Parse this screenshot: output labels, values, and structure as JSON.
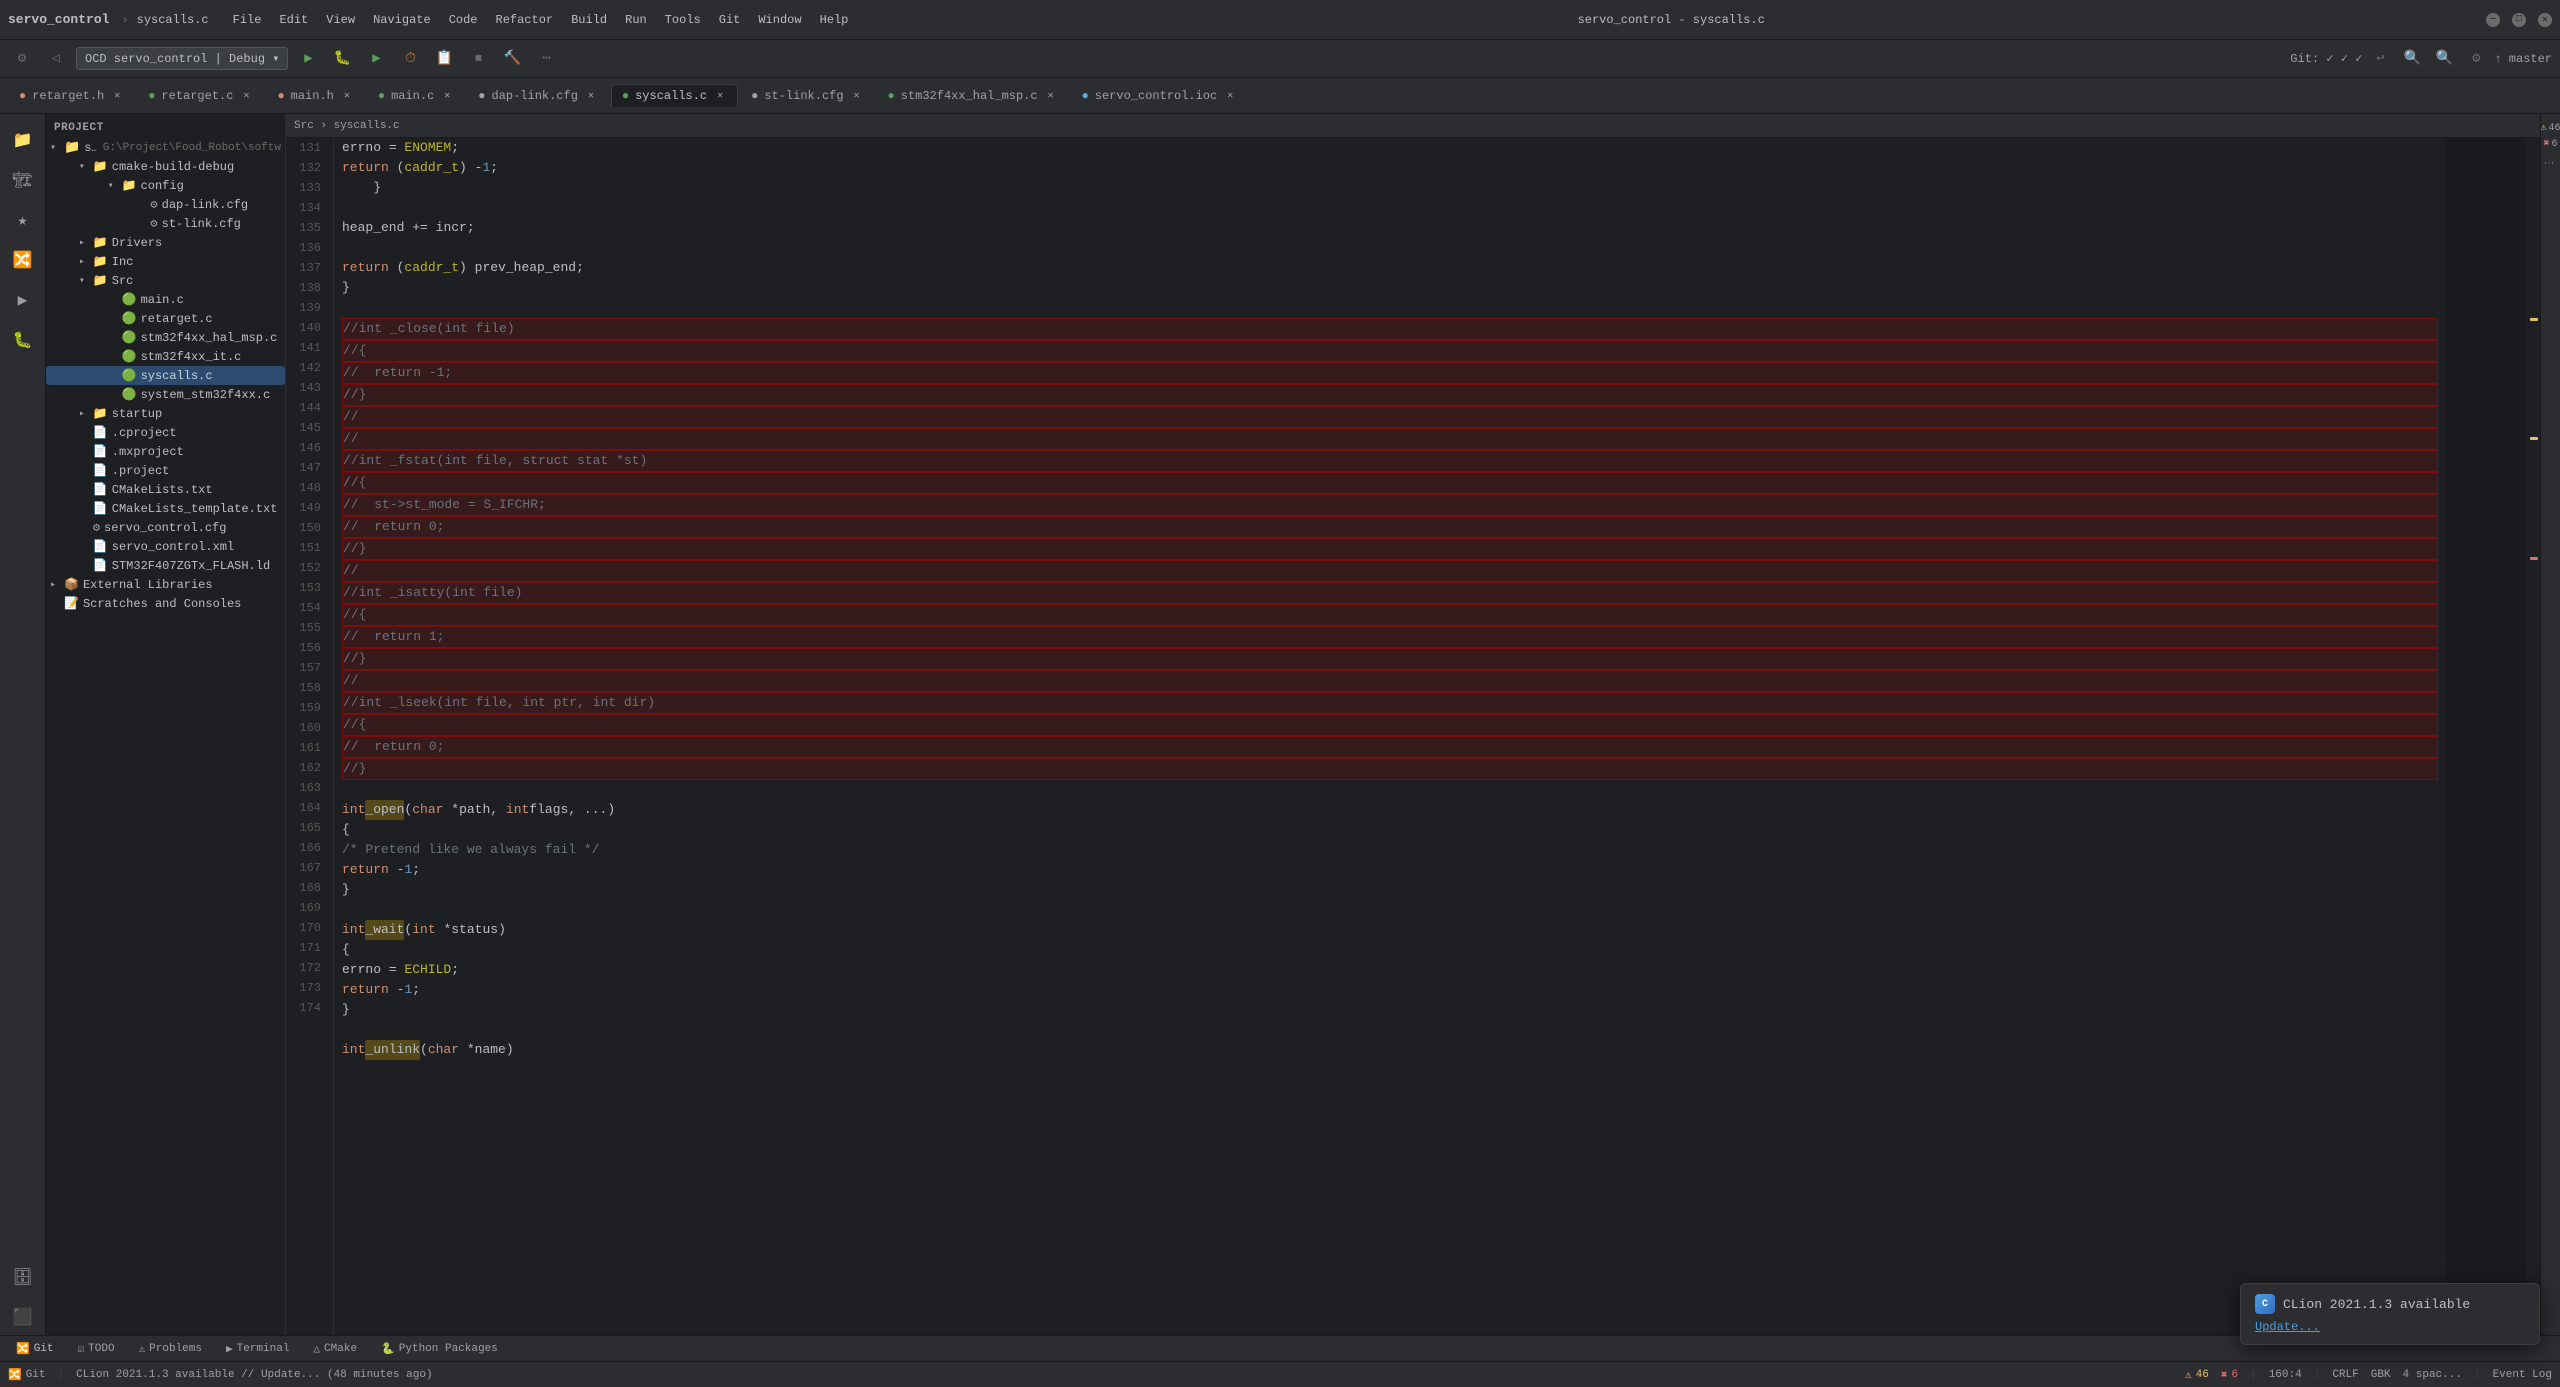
{
  "window": {
    "title": "servo_control - syscalls.c",
    "project": "servo_control",
    "separator": " - ",
    "file": "syscalls.c"
  },
  "titlebar": {
    "minimize": "—",
    "maximize": "□",
    "close": "✕"
  },
  "menubar": {
    "items": [
      "File",
      "Edit",
      "View",
      "Navigate",
      "Code",
      "Refactor",
      "Build",
      "Run",
      "Tools",
      "Git",
      "Window",
      "Help"
    ]
  },
  "tabs": [
    {
      "label": "retarget.h",
      "active": false,
      "modified": false
    },
    {
      "label": "retarget.c",
      "active": false,
      "modified": false
    },
    {
      "label": "main.h",
      "active": false,
      "modified": false
    },
    {
      "label": "main.c",
      "active": false,
      "modified": false
    },
    {
      "label": "dap-link.cfg",
      "active": false,
      "modified": false
    },
    {
      "label": "syscalls.c",
      "active": true,
      "modified": false
    },
    {
      "label": "st-link.cfg",
      "active": false,
      "modified": false
    },
    {
      "label": "stm32f4xx_hal_msp.c",
      "active": false,
      "modified": false
    },
    {
      "label": "servo_control.ioc",
      "active": false,
      "modified": false
    }
  ],
  "debug": {
    "config_label": "OCD servo_control | Debug",
    "branch": "master"
  },
  "file_tree": {
    "project_name": "servo_control",
    "project_path": "G:\\Project\\Food_Robot\\softw",
    "items": [
      {
        "level": 0,
        "type": "dir",
        "expanded": true,
        "label": "servo_control",
        "selected": false
      },
      {
        "level": 1,
        "type": "dir",
        "expanded": true,
        "label": "cmake-build-debug",
        "selected": false
      },
      {
        "level": 2,
        "type": "dir",
        "expanded": true,
        "label": "config",
        "selected": false
      },
      {
        "level": 3,
        "type": "file",
        "label": "dap-link.cfg",
        "selected": false
      },
      {
        "level": 3,
        "type": "file",
        "label": "st-link.cfg",
        "selected": false
      },
      {
        "level": 1,
        "type": "dir",
        "expanded": true,
        "label": "Drivers",
        "selected": false
      },
      {
        "level": 1,
        "type": "dir",
        "expanded": true,
        "label": "Inc",
        "selected": false
      },
      {
        "level": 1,
        "type": "dir",
        "expanded": true,
        "label": "Src",
        "selected": false
      },
      {
        "level": 2,
        "type": "file",
        "label": "main.c",
        "selected": false
      },
      {
        "level": 2,
        "type": "file",
        "label": "retarget.c",
        "selected": false
      },
      {
        "level": 2,
        "type": "file",
        "label": "stm32f4xx_hal_msp.c",
        "selected": false
      },
      {
        "level": 2,
        "type": "file",
        "label": "stm32f4xx_it.c",
        "selected": false
      },
      {
        "level": 2,
        "type": "file",
        "label": "syscalls.c",
        "selected": true
      },
      {
        "level": 2,
        "type": "file",
        "label": "system_stm32f4xx.c",
        "selected": false
      },
      {
        "level": 1,
        "type": "dir",
        "expanded": true,
        "label": "startup",
        "selected": false
      },
      {
        "level": 1,
        "type": "file",
        "label": ".cproject",
        "selected": false
      },
      {
        "level": 1,
        "type": "file",
        "label": ".mxproject",
        "selected": false
      },
      {
        "level": 1,
        "type": "file",
        "label": ".project",
        "selected": false
      },
      {
        "level": 1,
        "type": "file",
        "label": "CMakeLists.txt",
        "selected": false
      },
      {
        "level": 1,
        "type": "file",
        "label": "CMakeLists_template.txt",
        "selected": false
      },
      {
        "level": 1,
        "type": "file",
        "label": "servo_control.cfg",
        "selected": false
      },
      {
        "level": 1,
        "type": "file",
        "label": "servo_control.xml",
        "selected": false
      },
      {
        "level": 1,
        "type": "file",
        "label": "STM32F407ZGTx_FLASH.ld",
        "selected": false
      },
      {
        "level": 0,
        "type": "dir",
        "expanded": false,
        "label": "External Libraries",
        "selected": false
      },
      {
        "level": 0,
        "type": "item",
        "label": "Scratches and Consoles",
        "selected": false
      }
    ]
  },
  "code": {
    "lines": [
      {
        "num": 131,
        "content": "        errno = ENOMEM;",
        "highlighted": false
      },
      {
        "num": 132,
        "content": "        return (caddr_t) -1;",
        "highlighted": false
      },
      {
        "num": 133,
        "content": "    }",
        "highlighted": false
      },
      {
        "num": 134,
        "content": "",
        "highlighted": false
      },
      {
        "num": 135,
        "content": "    heap_end += incr;",
        "highlighted": false
      },
      {
        "num": 136,
        "content": "",
        "highlighted": false
      },
      {
        "num": 137,
        "content": "    return (caddr_t) prev_heap_end;",
        "highlighted": false
      },
      {
        "num": 138,
        "content": "}",
        "highlighted": false
      },
      {
        "num": 139,
        "content": "",
        "highlighted": false
      },
      {
        "num": 140,
        "content": "//int _close(int file)",
        "highlighted": true
      },
      {
        "num": 141,
        "content": "//{",
        "highlighted": true
      },
      {
        "num": 142,
        "content": "//  return -1;",
        "highlighted": true
      },
      {
        "num": 143,
        "content": "//}",
        "highlighted": true
      },
      {
        "num": 144,
        "content": "//",
        "highlighted": true
      },
      {
        "num": 145,
        "content": "//",
        "highlighted": true
      },
      {
        "num": 146,
        "content": "//int _fstat(int file, struct stat *st)",
        "highlighted": true
      },
      {
        "num": 147,
        "content": "//{",
        "highlighted": true
      },
      {
        "num": 148,
        "content": "//  st->st_mode = S_IFCHR;",
        "highlighted": true
      },
      {
        "num": 149,
        "content": "//  return 0;",
        "highlighted": true
      },
      {
        "num": 150,
        "content": "//}",
        "highlighted": true
      },
      {
        "num": 151,
        "content": "//",
        "highlighted": true
      },
      {
        "num": 152,
        "content": "//int _isatty(int file)",
        "highlighted": true
      },
      {
        "num": 153,
        "content": "//{",
        "highlighted": true
      },
      {
        "num": 154,
        "content": "//  return 1;",
        "highlighted": true
      },
      {
        "num": 155,
        "content": "//}",
        "highlighted": true
      },
      {
        "num": 156,
        "content": "//",
        "highlighted": true
      },
      {
        "num": 157,
        "content": "//int _lseek(int file, int ptr, int dir)",
        "highlighted": true
      },
      {
        "num": 158,
        "content": "//{",
        "highlighted": true
      },
      {
        "num": 159,
        "content": "//  return 0;",
        "highlighted": true
      },
      {
        "num": 160,
        "content": "//}",
        "highlighted": true
      },
      {
        "num": 161,
        "content": "",
        "highlighted": false
      },
      {
        "num": 162,
        "content": "int _open(char *path, int flags, ...)",
        "highlighted": false
      },
      {
        "num": 163,
        "content": "{",
        "highlighted": false
      },
      {
        "num": 164,
        "content": "    /* Pretend like we always fail */",
        "highlighted": false
      },
      {
        "num": 165,
        "content": "    return -1;",
        "highlighted": false
      },
      {
        "num": 166,
        "content": "}",
        "highlighted": false
      },
      {
        "num": 167,
        "content": "",
        "highlighted": false
      },
      {
        "num": 168,
        "content": "int _wait(int *status)",
        "highlighted": false
      },
      {
        "num": 169,
        "content": "{",
        "highlighted": false
      },
      {
        "num": 170,
        "content": "    errno = ECHILD;",
        "highlighted": false
      },
      {
        "num": 171,
        "content": "    return -1;",
        "highlighted": false
      },
      {
        "num": 172,
        "content": "}",
        "highlighted": false
      },
      {
        "num": 173,
        "content": "",
        "highlighted": false
      },
      {
        "num": 174,
        "content": "int _unlink(char *name)",
        "highlighted": false
      }
    ]
  },
  "status": {
    "git_branch": "Git: ✓ ✓ ✓ 🕐 ↩ 🔍",
    "warnings": "46",
    "errors": "6",
    "position": "160:4",
    "encoding": "CRLF",
    "charset": "GBK",
    "indent": "4 spac...",
    "branch_label": "↑ master",
    "clion_available": "CLion 2021.1.3 available",
    "clion_update": "Update...",
    "clion_info": "CLion 2021.1.3 available // Update... (48 minutes ago)"
  },
  "bottom_tabs": [
    {
      "label": "Git",
      "icon": "🔀",
      "active": false
    },
    {
      "label": "TODO",
      "icon": "☑",
      "active": false
    },
    {
      "label": "Problems",
      "icon": "⚠",
      "active": false,
      "badge": ""
    },
    {
      "label": "Terminal",
      "icon": "▶",
      "active": false
    },
    {
      "label": "CMake",
      "icon": "Δ",
      "active": false
    },
    {
      "label": "Python Packages",
      "icon": "🐍",
      "active": false
    }
  ]
}
